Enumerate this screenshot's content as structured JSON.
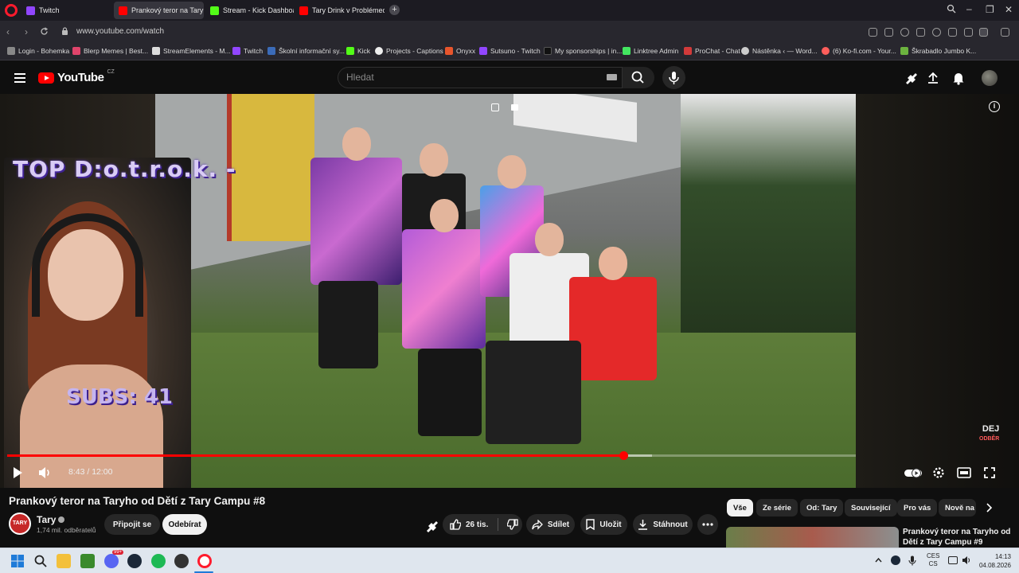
{
  "browser": {
    "tabs": [
      {
        "label": "Twitch",
        "color": "#9146ff"
      },
      {
        "label": "Prankový teror na Tary",
        "color": "#ff0000"
      },
      {
        "label": "Stream - Kick Dashboard",
        "color": "#53fc18"
      },
      {
        "label": "Tary Drink v Problémech -",
        "color": "#ff0000"
      }
    ],
    "address": "www.youtube.com/watch",
    "bookmarks": [
      "Login - Bohemka",
      "Blerp Memes | Best...",
      "StreamElements - M...",
      "Twitch",
      "Školní informační sy...",
      "Kick",
      "Projects - Captions",
      "Onyxx",
      "Sutsuno - Twitch",
      "My sponsorships | in...",
      "Linktree Admin",
      "ProChat - Chat",
      "Nástěnka ‹ — Word...",
      "(6) Ko-fi.com - Your...",
      "Škrabadlo Jumbo K..."
    ]
  },
  "youtube": {
    "logo_text": "YouTube",
    "region": "CZ",
    "search_placeholder": "Hledat",
    "player": {
      "overlay_top": "TOP D:o.t.r.o.k. -",
      "overlay_subs": "SUBS: 41",
      "logo_text": [
        "DEJ",
        "ODBĚR"
      ],
      "time_current": "8:43",
      "time_separator": "/",
      "time_total": "12:00",
      "progress_fraction": 0.7264,
      "buffered_fraction": 0.76
    },
    "video": {
      "title": "Prankový teror na Taryho od Dětí z Tary Campu #8",
      "channel": "Tary",
      "channel_avatar_text": "TARY",
      "subscribers": "1,74 mil. odběratelů",
      "join_label": "Připojit se",
      "subscribe_label": "Odebírat",
      "likes": "26 tis.",
      "share_label": "Sdílet",
      "save_label": "Uložit",
      "download_label": "Stáhnout"
    },
    "chips": [
      "Vše",
      "Ze série",
      "Od: Tary",
      "Související",
      "Pro vás",
      "Nově na"
    ],
    "recommended": {
      "title": "Prankový teror na Taryho od Dětí z Tary Campu #9"
    }
  },
  "taskbar": {
    "lang": "CES",
    "lang2": "CS",
    "time": "14:13",
    "date": "04.08.2026",
    "badge": "99+"
  }
}
